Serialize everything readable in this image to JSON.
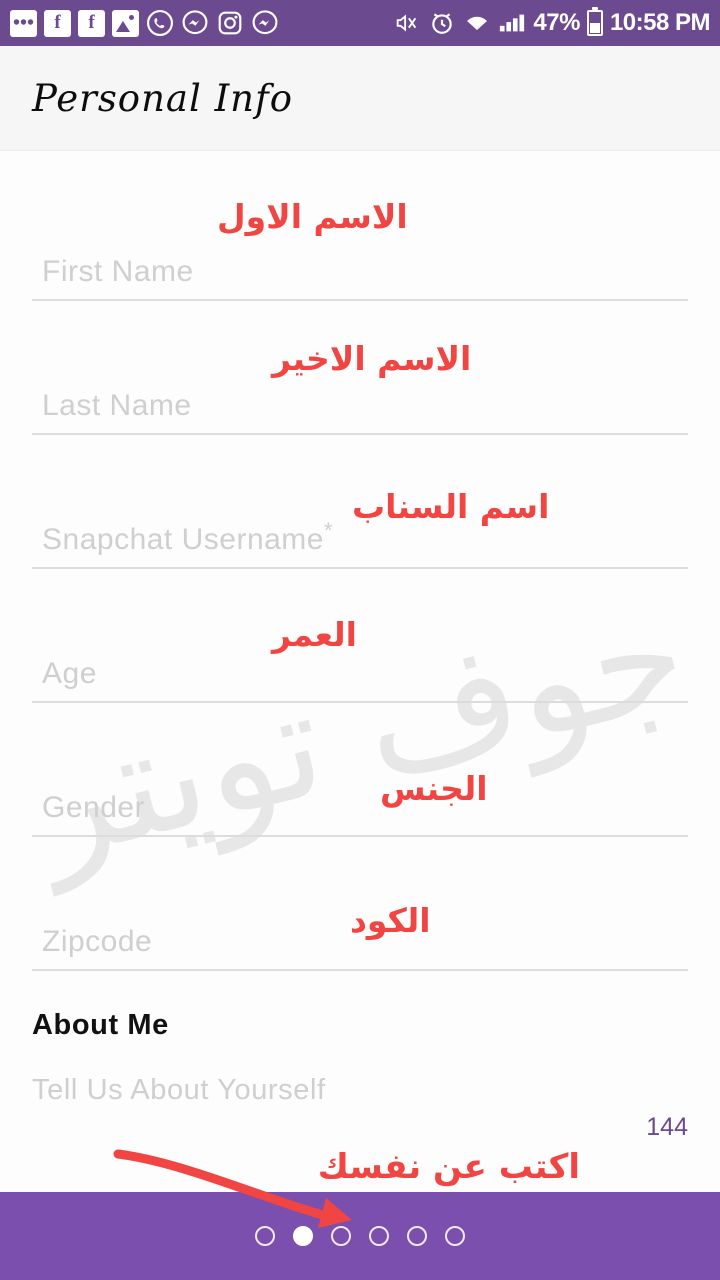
{
  "status_bar": {
    "background": "#6b4a8f",
    "left_icons": [
      {
        "name": "messages-dots-icon",
        "glyph": "•••"
      },
      {
        "name": "facebook-icon-1",
        "glyph": "f"
      },
      {
        "name": "facebook-icon-2",
        "glyph": "f"
      },
      {
        "name": "photos-icon",
        "glyph": "image"
      },
      {
        "name": "whatsapp-icon",
        "glyph": "✆"
      },
      {
        "name": "messenger-icon-1",
        "glyph": "⌁"
      },
      {
        "name": "instagram-icon",
        "glyph": "⊡"
      },
      {
        "name": "messenger-icon-2",
        "glyph": "⌁"
      }
    ],
    "right_icons": [
      {
        "name": "vibrate-mute-icon",
        "glyph": "⃠"
      },
      {
        "name": "alarm-icon",
        "glyph": "⏰"
      },
      {
        "name": "wifi-icon",
        "glyph": "wifi"
      },
      {
        "name": "cellular-signal-icon",
        "glyph": "signal"
      }
    ],
    "battery_percent": "47%",
    "clock": "10:58 PM"
  },
  "app_bar": {
    "title": "Personal Info"
  },
  "watermark": {
    "text": "جوف تويتر"
  },
  "form": {
    "fields": [
      {
        "name": "first-name",
        "label": "First Name",
        "placeholder": "First Name",
        "value": "",
        "required": false,
        "annotation": "الاسم الاول"
      },
      {
        "name": "last-name",
        "label": "Last Name",
        "placeholder": "Last Name",
        "value": "",
        "required": false,
        "annotation": "الاسم الاخير"
      },
      {
        "name": "snapchat-username",
        "label": "Snapchat Username",
        "placeholder": "Snapchat Username",
        "value": "",
        "required": true,
        "required_mark": "*",
        "annotation": "اسم السناب"
      },
      {
        "name": "age",
        "label": "Age",
        "placeholder": "Age",
        "value": "",
        "required": false,
        "annotation": "العمر"
      },
      {
        "name": "gender",
        "label": "Gender",
        "placeholder": "Gender",
        "value": "",
        "required": false,
        "annotation": "الجنس"
      },
      {
        "name": "zipcode",
        "label": "Zipcode",
        "placeholder": "Zipcode",
        "value": "",
        "required": false,
        "annotation": "الكود"
      }
    ]
  },
  "about_me": {
    "title": "About Me",
    "placeholder": "Tell Us About Yourself",
    "value": "",
    "char_counter": "144",
    "counter_color": "#6b4a8f",
    "annotation": "اكتب عن نفسك"
  },
  "annotation": {
    "arrow_color": "#f04542",
    "text_color": "#f04542"
  },
  "bottom_bar": {
    "background": "#7b4fae",
    "step_count": 6,
    "active_step": 2
  }
}
